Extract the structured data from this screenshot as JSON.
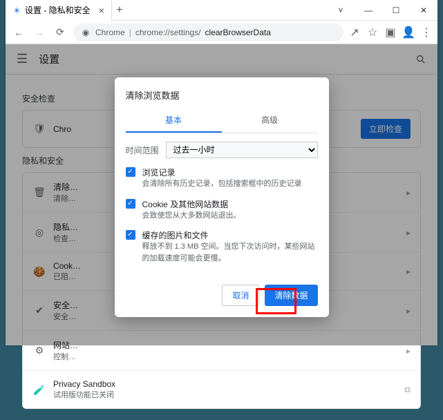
{
  "window": {
    "tab_title": "设置 - 隐私和安全",
    "new_tab_tooltip": "+"
  },
  "address_bar": {
    "chrome_label": "Chrome",
    "url_prefix": "chrome://settings/",
    "url_suffix": "clearBrowserData"
  },
  "settings": {
    "title": "设置",
    "section_security": "安全检查",
    "security_row_title": "Chro",
    "check_now_button": "立即检查",
    "section_privacy": "隐私和安全",
    "rows": [
      {
        "icon": "trash",
        "title": "清除…",
        "sub": "清除…"
      },
      {
        "icon": "target",
        "title": "隐私…",
        "sub": "检查…"
      },
      {
        "icon": "cookie",
        "title": "Cook…",
        "sub": "已阻…"
      },
      {
        "icon": "shield",
        "title": "安全…",
        "sub": "安全…"
      },
      {
        "icon": "sliders",
        "title": "网站…",
        "sub": "控制…"
      },
      {
        "icon": "flask",
        "title": "Privacy Sandbox",
        "sub": "试用版功能已关闭"
      }
    ]
  },
  "dialog": {
    "title": "清除浏览数据",
    "tab_basic": "基本",
    "tab_advanced": "高级",
    "time_label": "时间范围",
    "time_value": "过去一小时",
    "checks": [
      {
        "title": "浏览记录",
        "sub": "会清除所有历史记录，包括搜索框中的历史记录"
      },
      {
        "title": "Cookie 及其他网站数据",
        "sub": "会致使您从大多数网站退出。"
      },
      {
        "title": "缓存的图片和文件",
        "sub": "释放不到 1.3 MB 空间。当您下次访问时，某些网站的加载速度可能会更慢。"
      }
    ],
    "cancel": "取消",
    "confirm": "清除数据"
  }
}
